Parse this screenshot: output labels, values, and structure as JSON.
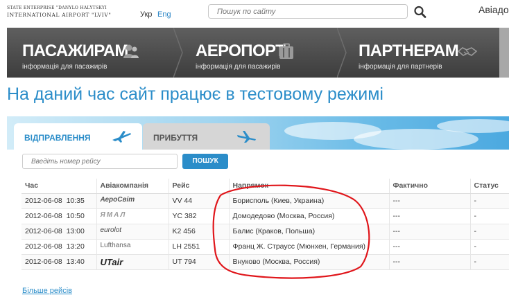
{
  "header": {
    "logo_line1": "STATE ENTERPRISE \"DANYLO HALYTSKYI",
    "logo_line2": "INTERNATIONAL AIRPORT \"LVIV\"",
    "lang_ukr": "Укр",
    "lang_eng": "Eng",
    "search_placeholder": "Пошук по сайту",
    "top_right": "Авіадо"
  },
  "nav": [
    {
      "title": "ПАСАЖИРАМ",
      "subtitle": "інформація для пасажирів",
      "icon": "passengers-icon"
    },
    {
      "title": "АЕРОПОРТ",
      "subtitle": "інформація для пасажирів",
      "icon": "luggage-icon"
    },
    {
      "title": "ПАРТНЕРАМ",
      "subtitle": "інформація для партнерів",
      "icon": "handshake-icon"
    }
  ],
  "headline": "На даний час сайт працює в тестовому режимі",
  "tabs": {
    "departures": "Відправлення",
    "arrivals": "Прибуття"
  },
  "flight_search": {
    "placeholder": "Введіть номер рейсу",
    "button": "ПОШУК"
  },
  "table": {
    "headers": [
      "Час",
      "Авіакомпанія",
      "Рейс",
      "Напрямок",
      "Фактично",
      "Статус"
    ],
    "rows": [
      {
        "date": "2012-06-08",
        "time": "10:35",
        "airline": "АероСвіт",
        "flight": "VV 44",
        "direction": "Борисполь (Киев, Украина)",
        "actual": "---",
        "status": "-"
      },
      {
        "date": "2012-06-08",
        "time": "10:50",
        "airline": "ЯМАЛ",
        "flight": "YC 382",
        "direction": "Домодедово (Москва, Россия)",
        "actual": "---",
        "status": "-"
      },
      {
        "date": "2012-06-08",
        "time": "13:00",
        "airline": "eurolot",
        "flight": "K2 456",
        "direction": "Балис (Краков, Польша)",
        "actual": "---",
        "status": "-"
      },
      {
        "date": "2012-06-08",
        "time": "13:20",
        "airline": "Lufthansa",
        "flight": "LH 2551",
        "direction": "Франц Ж. Страусс (Мюнхен, Германия)",
        "actual": "---",
        "status": "-"
      },
      {
        "date": "2012-06-08",
        "time": "13:40",
        "airline": "UTair",
        "flight": "UT 794",
        "direction": "Внуково (Москва, Россия)",
        "actual": "---",
        "status": "-"
      }
    ]
  },
  "more_link": "Більше рейсів",
  "colors": {
    "accent": "#2b8dc9",
    "nav_bg": "#4a4a4a",
    "annotation": "#e0161b"
  }
}
